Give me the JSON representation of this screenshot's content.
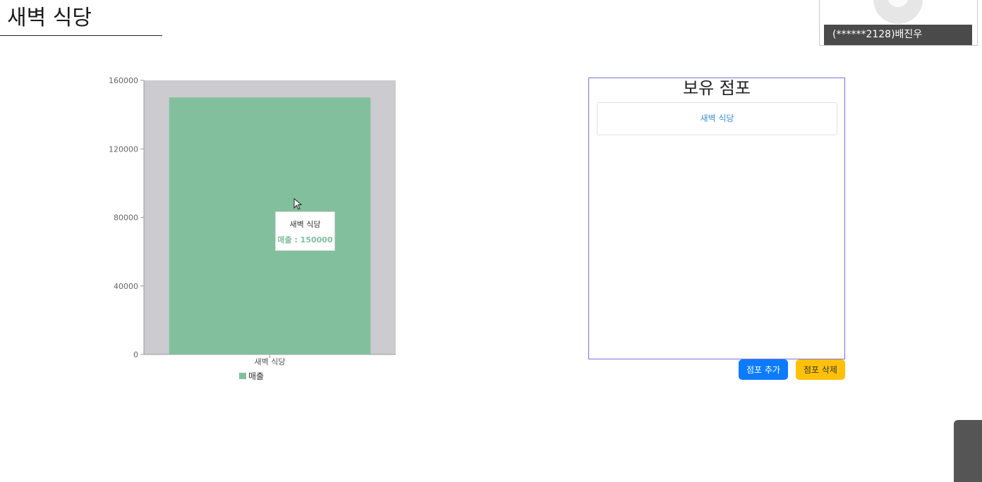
{
  "page": {
    "title": "새벽 식당"
  },
  "video": {
    "participant": "(******2128)배진우"
  },
  "tooltip": {
    "name": "새벽 식당",
    "value_line": "매출 : 150000"
  },
  "stores": {
    "title": "보유 점포",
    "items": [
      "새벽 식당"
    ],
    "add_label": "점포 추가",
    "delete_label": "점포 삭제"
  },
  "colors": {
    "bar": "#82c09d",
    "bar_bg": "#ccccd0",
    "panel_border": "#7a6fe0",
    "add_button": "#0d7bff",
    "delete_button": "#ffc107"
  },
  "chart_data": {
    "type": "bar",
    "categories": [
      "새벽 식당"
    ],
    "series": [
      {
        "name": "매출",
        "values": [
          150000
        ]
      }
    ],
    "yticks": [
      0,
      40000,
      80000,
      120000,
      160000
    ],
    "ylim": [
      0,
      160000
    ],
    "legend": "bottom",
    "highlighted_category": "새벽 식당"
  }
}
